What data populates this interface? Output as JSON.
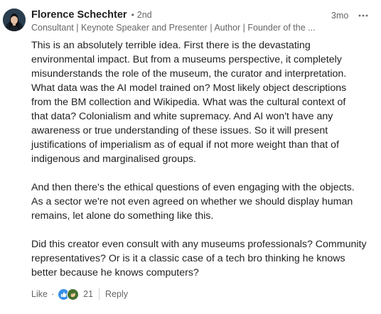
{
  "comment": {
    "author": {
      "name": "Florence Schechter",
      "degree": "2nd",
      "headline": "Consultant | Keynote Speaker and Presenter | Author | Founder of the ..."
    },
    "timestamp": "3mo",
    "more_label": "•••",
    "body": {
      "paragraph_1": "This is an absolutely terrible idea. First there is the devastating\nenvironmental impact. But from a museums perspective, it completely\nmisunderstands the role of the museum, the curator and interpretation.\nWhat data was the AI model trained on? Most likely object descriptions\nfrom the BM collection and Wikipedia. What was the cultural context of\nthat data? Colonialism and white supremacy. And AI won't have any\nawareness or true understanding of these issues. So it will present\njustifications of imperialism as of equal if not more weight than that of\nindigenous and marginalised groups.",
      "paragraph_2": "And then there's the ethical questions of even engaging with the objects.\nAs a sector we're not even agreed on whether we should display human\nremains, let alone do something like this.",
      "paragraph_3": "Did this creator even consult with any museums professionals? Community\nrepresentatives? Or is it a classic case of a tech bro thinking he knows\nbetter because he knows computers?"
    },
    "actions": {
      "like_label": "Like",
      "separator": "·",
      "reaction_icons": [
        "like-icon",
        "celebrate-icon"
      ],
      "reaction_count": "21",
      "reply_label": "Reply"
    },
    "colors": {
      "name": "#1f1f1f",
      "secondary_text": "#666666",
      "like_blue": "#378fe9",
      "celebrate_green": "#44712e"
    }
  }
}
